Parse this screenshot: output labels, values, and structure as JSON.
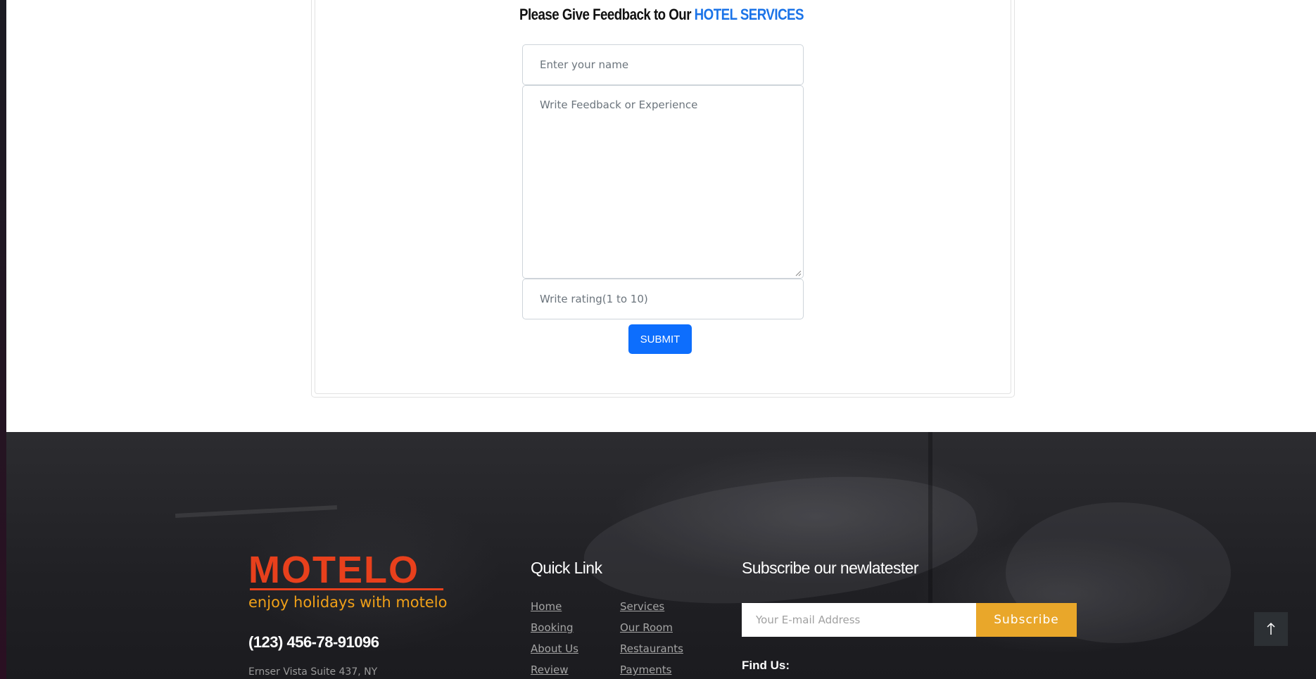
{
  "feedback": {
    "title_prefix": "Please Give Feedback to Our ",
    "title_accent": "HOTEL SERVICES",
    "name_placeholder": "Enter your name",
    "feedback_placeholder": "Write Feedback or Experience",
    "rating_placeholder": "Write rating(1 to 10)",
    "submit_label": "SUBMIT"
  },
  "footer": {
    "logo": "MOTELO",
    "tagline": "enjoy holidays with motelo",
    "phone": "(123) 456-78-91096",
    "address": "Ernser Vista Suite 437, NY",
    "quick_link_title": "Quick Link",
    "quick_links_col1": [
      "Home",
      "Booking",
      "About Us",
      "Review"
    ],
    "quick_links_col2": [
      "Services",
      "Our Room",
      "Restaurants",
      "Payments"
    ],
    "subscribe_title": "Subscribe our newlatester",
    "email_placeholder": "Your E-mail Address",
    "subscribe_label": "Subscribe",
    "find_us_label": "Find Us:"
  },
  "icons": {
    "back_to_top": "arrow-up-icon",
    "resize": "resize-grip-icon"
  },
  "colors": {
    "accent_blue": "#1a73e8",
    "submit_blue": "#0d6efd",
    "logo_orange": "#e8401c",
    "tagline_orange": "#f0a018",
    "subscribe_yellow": "#e9a72a"
  }
}
